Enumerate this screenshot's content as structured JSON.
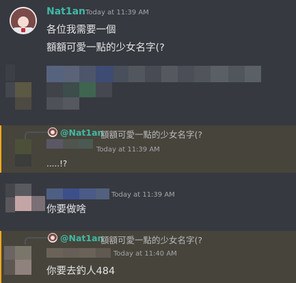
{
  "first_message": {
    "author": "Nat1an",
    "timestamp": "Today at 11:39 AM",
    "lines": [
      "各位我需要一個",
      "額額可愛一點的少女名字(?"
    ]
  },
  "reply1": {
    "reply_to": "@Nat1an",
    "reply_preview": "額額可愛一點的少女名字(?",
    "timestamp": "Today at 11:39 AM",
    "text": ".....!?"
  },
  "message3": {
    "timestamp": "Today at 11:39 AM",
    "text": "你要做啥"
  },
  "reply2": {
    "reply_to": "@Nat1an",
    "reply_preview": "額額可愛一點的少女名字(?",
    "timestamp": "Today at 11:40 AM",
    "text": "你要去釣人484"
  },
  "colors": {
    "background": "#36393f",
    "highlight": "#47443b",
    "username": "#3fb9a6",
    "text": "#e2e3e5",
    "timestamp": "#a3a6aa"
  },
  "icons": [
    "avatar",
    "reply-avatar"
  ]
}
